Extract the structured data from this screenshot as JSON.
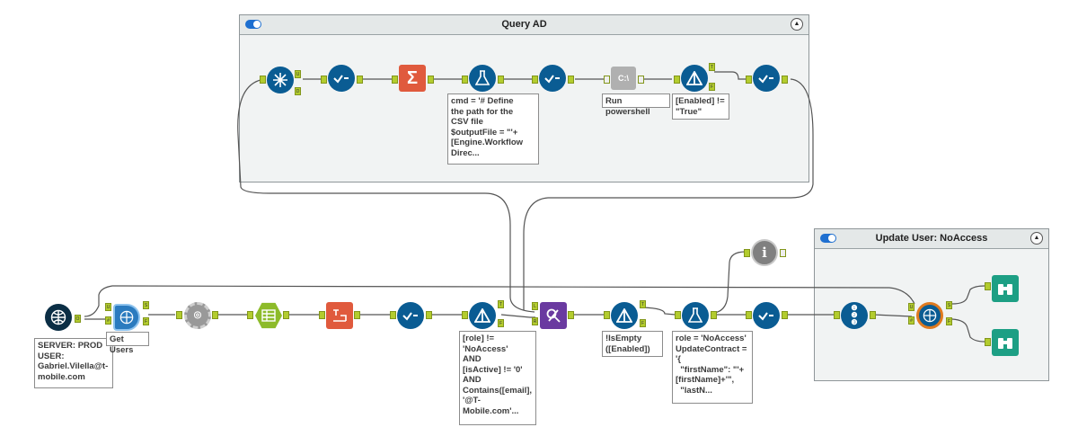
{
  "containers": {
    "query_ad": {
      "title": "Query AD"
    },
    "update_user": {
      "title": "Update User: NoAccess"
    }
  },
  "annotations": {
    "input_conn": "SERVER: PROD\nUSER:\nGabriel.Vilella@t-\nmobile.com",
    "get_users": "Get Users",
    "formula_cmd": "cmd = '# Define\nthe path for the\nCSV file\n$outputFile = \"'+\n[Engine.Workflow\nDirec...",
    "run_powershell": "Run powershell",
    "filter_enabled": "[Enabled] !=\n\"True\"",
    "filter_role": "[role] !=\n'NoAccess'\nAND\n[isActive] != '0'\nAND\nContains([email],\n'@T-\nMobile.com'...",
    "filter_isempty": "!IsEmpty\n([Enabled])",
    "formula_role": "role = 'NoAccess'\nUpdateContract =\n'{\n  \"firstName\": \"'+\n[firstName]+'\",\n  \"lastN..."
  },
  "tools": [
    {
      "name": "input-data-icon",
      "color": "#0b2e45"
    },
    {
      "name": "download-icon",
      "color": "#2b7bbf"
    },
    {
      "name": "json-parse-icon",
      "color": "#8a8a8a"
    },
    {
      "name": "crosstab-icon",
      "color": "#8dbb2a"
    },
    {
      "name": "text-to-columns-icon",
      "color": "#e05a3d"
    },
    {
      "name": "select-icon",
      "color": "#0a5c93"
    },
    {
      "name": "filter-icon",
      "color": "#0a5c93"
    },
    {
      "name": "join-icon",
      "color": "#6a3aa0"
    },
    {
      "name": "formula-icon",
      "color": "#0a5c93"
    },
    {
      "name": "record-id-icon",
      "color": "#0a5c93"
    },
    {
      "name": "browse-icon",
      "color": "#1d9f84"
    },
    {
      "name": "dynamic-input-icon",
      "color": "#0a5c93"
    },
    {
      "name": "summarize-icon",
      "color": "#e05a3d"
    },
    {
      "name": "run-command-icon",
      "color": "#aaaaaa"
    },
    {
      "name": "message-icon",
      "color": "#808080"
    }
  ]
}
